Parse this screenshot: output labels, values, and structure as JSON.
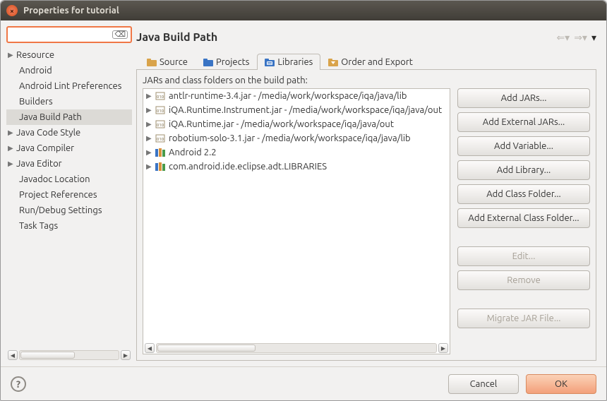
{
  "window_title": "Properties for tutorial",
  "filter": {
    "value": "",
    "placeholder": ""
  },
  "sidebar": {
    "items": [
      {
        "label": "Resource",
        "expandable": true,
        "child": false
      },
      {
        "label": "Android",
        "expandable": false,
        "child": true
      },
      {
        "label": "Android Lint Preferences",
        "expandable": false,
        "child": true
      },
      {
        "label": "Builders",
        "expandable": false,
        "child": true
      },
      {
        "label": "Java Build Path",
        "expandable": false,
        "child": true,
        "selected": true
      },
      {
        "label": "Java Code Style",
        "expandable": true,
        "child": false
      },
      {
        "label": "Java Compiler",
        "expandable": true,
        "child": false
      },
      {
        "label": "Java Editor",
        "expandable": true,
        "child": false
      },
      {
        "label": "Javadoc Location",
        "expandable": false,
        "child": true
      },
      {
        "label": "Project References",
        "expandable": false,
        "child": true
      },
      {
        "label": "Run/Debug Settings",
        "expandable": false,
        "child": true
      },
      {
        "label": "Task Tags",
        "expandable": false,
        "child": true
      }
    ]
  },
  "heading": "Java Build Path",
  "tabs": [
    {
      "label": "Source"
    },
    {
      "label": "Projects"
    },
    {
      "label": "Libraries",
      "active": true
    },
    {
      "label": "Order and Export"
    }
  ],
  "description": "JARs and class folders on the build path:",
  "entries": [
    {
      "kind": "jar",
      "label": "antlr-runtime-3.4.jar - /media/work/workspace/iqa/java/lib"
    },
    {
      "kind": "jar",
      "label": "iQA.Runtime.Instrument.jar - /media/work/workspace/iqa/java/out"
    },
    {
      "kind": "jar",
      "label": "iQA.Runtime.jar - /media/work/workspace/iqa/java/out"
    },
    {
      "kind": "jar",
      "label": "robotium-solo-3.1.jar - /media/work/workspace/iqa/java/lib"
    },
    {
      "kind": "lib",
      "label": "Android 2.2"
    },
    {
      "kind": "lib",
      "label": "com.android.ide.eclipse.adt.LIBRARIES"
    }
  ],
  "buttons": {
    "add_jars": "Add JARs...",
    "add_ext_jars": "Add External JARs...",
    "add_variable": "Add Variable...",
    "add_library": "Add Library...",
    "add_class_folder": "Add Class Folder...",
    "add_ext_class_folder": "Add External Class Folder...",
    "edit": "Edit...",
    "remove": "Remove",
    "migrate": "Migrate JAR File..."
  },
  "footer": {
    "cancel": "Cancel",
    "ok": "OK"
  }
}
